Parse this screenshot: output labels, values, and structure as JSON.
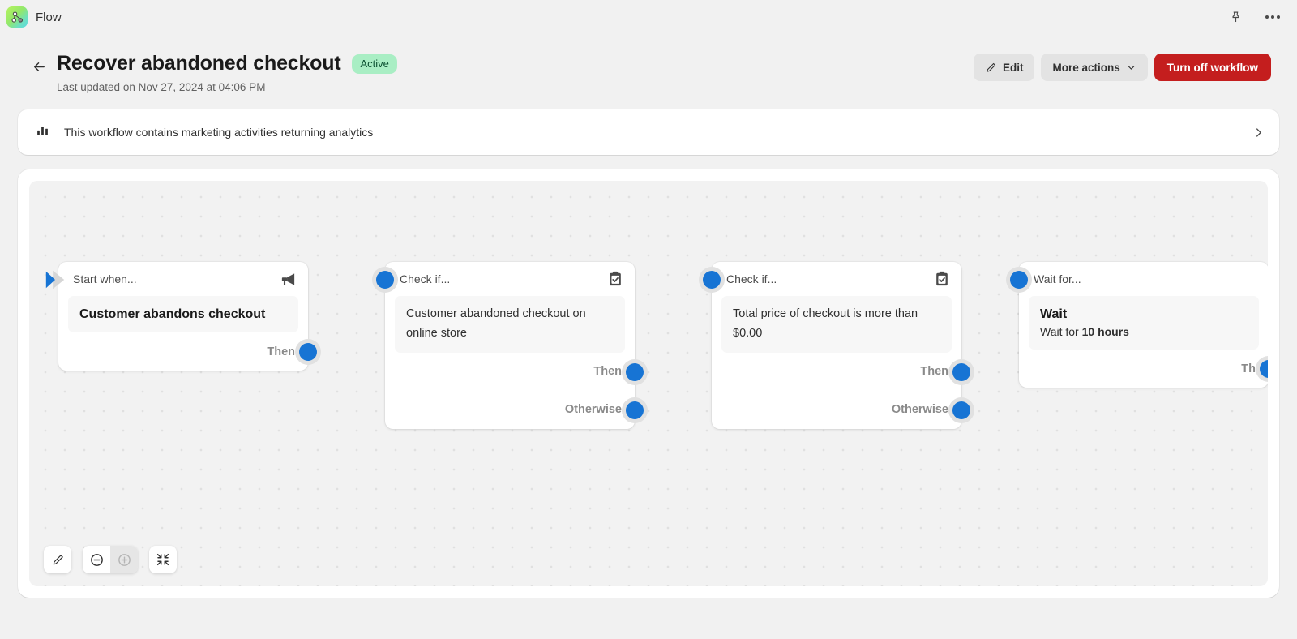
{
  "appbar": {
    "logo_icon": "flow-nodes-icon",
    "title": "Flow",
    "pin_icon": "pin-icon",
    "more_icon": "more-menu-icon"
  },
  "header": {
    "back_icon": "back-arrow-icon",
    "title": "Recover abandoned checkout",
    "status_badge": "Active",
    "subtitle": "Last updated on Nov 27, 2024 at 04:06 PM",
    "edit_label": "Edit",
    "edit_icon": "pencil-icon",
    "more_actions_label": "More actions",
    "more_actions_icon": "chevron-down-icon",
    "turn_off_label": "Turn off workflow"
  },
  "banner": {
    "icon": "bar-chart-icon",
    "text": "This workflow contains marketing activities returning analytics",
    "chevron_icon": "chevron-right-icon"
  },
  "canvas": {
    "nodes": [
      {
        "id": "trigger",
        "head_label": "Start when...",
        "head_icon": "megaphone-icon",
        "body_title": "Customer abandons checkout",
        "body_text": "",
        "ports": [
          "Then"
        ],
        "start_marker_icon": "start-arrow-icon"
      },
      {
        "id": "condition-1",
        "head_label": "Check if...",
        "head_icon": "clipboard-check-icon",
        "body_title": "",
        "body_text": "Customer abandoned checkout on online store",
        "ports": [
          "Then",
          "Otherwise"
        ]
      },
      {
        "id": "condition-2",
        "head_label": "Check if...",
        "head_icon": "clipboard-check-icon",
        "body_title": "",
        "body_text": "Total price of checkout is more than $0.00",
        "ports": [
          "Then",
          "Otherwise"
        ]
      },
      {
        "id": "wait",
        "head_label": "Wait for...",
        "head_icon": "",
        "body_title": "Wait",
        "body_sub_prefix": "Wait for ",
        "body_sub_strong": "10 hours",
        "ports": [
          "Th"
        ]
      }
    ],
    "tools": {
      "edit_icon": "pencil-icon",
      "zoom_out_icon": "zoom-out-icon",
      "zoom_in_icon": "zoom-in-icon",
      "fit_icon": "fit-to-screen-icon"
    }
  },
  "colors": {
    "accent_blue": "#1774d4",
    "critical_red": "#c41e1e",
    "badge_green_bg": "#a9eec4",
    "badge_green_text": "#0c5132"
  }
}
